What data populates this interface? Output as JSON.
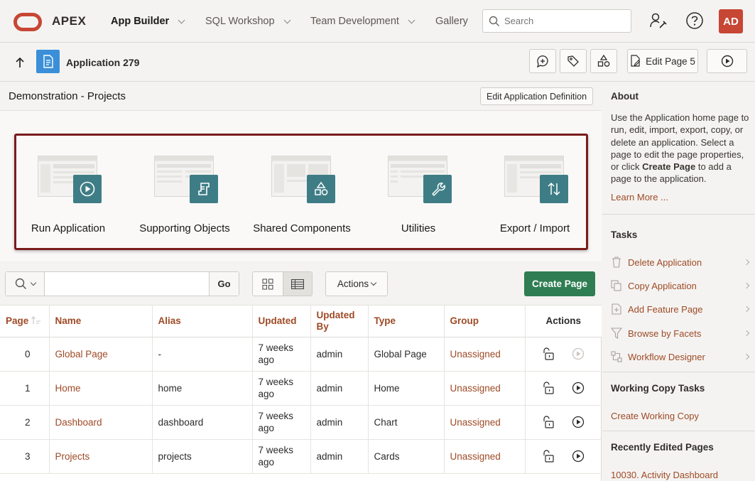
{
  "topnav": {
    "logo_text": "APEX",
    "items": [
      {
        "label": "App Builder",
        "has_menu": true,
        "active": true
      },
      {
        "label": "SQL Workshop",
        "has_menu": true
      },
      {
        "label": "Team Development",
        "has_menu": true
      },
      {
        "label": "Gallery",
        "has_menu": false
      }
    ],
    "search_placeholder": "Search",
    "avatar_initials": "AD"
  },
  "subbar": {
    "application_title": "Application 279",
    "edit_page_label": "Edit Page 5"
  },
  "region": {
    "title": "Demonstration - Projects",
    "edit_definition_label": "Edit Application Definition"
  },
  "tiles": [
    {
      "label": "Run Application",
      "icon": "play-icon"
    },
    {
      "label": "Supporting Objects",
      "icon": "scroll-icon"
    },
    {
      "label": "Shared Components",
      "icon": "shapes-icon"
    },
    {
      "label": "Utilities",
      "icon": "wrench-icon"
    },
    {
      "label": "Export / Import",
      "icon": "up-down-arrows-icon"
    }
  ],
  "toolbar": {
    "go_label": "Go",
    "actions_label": "Actions",
    "create_page_label": "Create Page"
  },
  "table": {
    "headers": {
      "page": "Page",
      "name": "Name",
      "alias": "Alias",
      "updated": "Updated",
      "updated_by": "Updated By",
      "type": "Type",
      "group": "Group",
      "actions": "Actions"
    },
    "rows": [
      {
        "page": "0",
        "name": "Global Page",
        "alias": "-",
        "updated": "7 weeks ago",
        "updated_by": "admin",
        "type": "Global Page",
        "group": "Unassigned",
        "run_enabled": false
      },
      {
        "page": "1",
        "name": "Home",
        "alias": "home",
        "updated": "7 weeks ago",
        "updated_by": "admin",
        "type": "Home",
        "group": "Unassigned",
        "run_enabled": true
      },
      {
        "page": "2",
        "name": "Dashboard",
        "alias": "dashboard",
        "updated": "7 weeks ago",
        "updated_by": "admin",
        "type": "Chart",
        "group": "Unassigned",
        "run_enabled": true
      },
      {
        "page": "3",
        "name": "Projects",
        "alias": "projects",
        "updated": "7 weeks ago",
        "updated_by": "admin",
        "type": "Cards",
        "group": "Unassigned",
        "run_enabled": true
      }
    ]
  },
  "sidebar": {
    "about_title": "About",
    "about_text_1": "Use the Application home page to run, edit, import, export, copy, or delete an application. Select a page to edit the page properties, or click ",
    "about_text_bold": "Create Page",
    "about_text_2": " to add a page to the application.",
    "learn_more": "Learn More ...",
    "tasks_title": "Tasks",
    "tasks": [
      {
        "label": "Delete Application",
        "icon": "trash-icon"
      },
      {
        "label": "Copy Application",
        "icon": "copy-icon"
      },
      {
        "label": "Add Feature Page",
        "icon": "add-page-icon"
      },
      {
        "label": "Browse by Facets",
        "icon": "filter-icon"
      },
      {
        "label": "Workflow Designer",
        "icon": "workflow-icon"
      }
    ],
    "working_copy_title": "Working Copy Tasks",
    "create_working_copy": "Create Working Copy",
    "recent_title": "Recently Edited Pages",
    "recent_items": [
      "10030. Activity Dashboard"
    ]
  },
  "colors": {
    "brand_red": "#c74634",
    "link": "#9e4a26",
    "teal_badge": "#3e7d86",
    "create_green": "#2f7d52",
    "highlight_frame": "#7a1c1c"
  }
}
